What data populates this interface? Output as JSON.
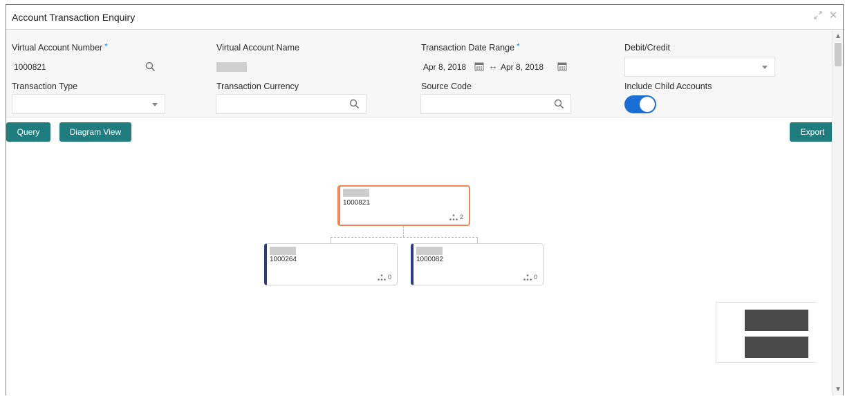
{
  "window": {
    "title": "Account Transaction Enquiry",
    "minimize_icon": "collapse-arrows-icon",
    "close_icon": "close-icon"
  },
  "form": {
    "virtual_account_number": {
      "label": "Virtual Account Number",
      "required_mark": "*",
      "value": "1000821",
      "icon": "search-icon"
    },
    "virtual_account_name": {
      "label": "Virtual Account Name",
      "value_masked": true
    },
    "transaction_date_range": {
      "label": "Transaction Date Range",
      "required_mark": "*",
      "from": "Apr 8, 2018",
      "to": "Apr 8, 2018",
      "separator": "↔",
      "icon": "calendar-icon"
    },
    "debit_credit": {
      "label": "Debit/Credit",
      "value": ""
    },
    "transaction_type": {
      "label": "Transaction Type",
      "value": ""
    },
    "transaction_currency": {
      "label": "Transaction Currency",
      "value": "",
      "icon": "search-icon"
    },
    "source_code": {
      "label": "Source Code",
      "value": "",
      "icon": "search-icon"
    },
    "include_child_accounts": {
      "label": "Include Child Accounts",
      "on": true
    }
  },
  "toolbar": {
    "query_label": "Query",
    "diagram_view_label": "Diagram View",
    "export_label": "Export"
  },
  "diagram": {
    "root": {
      "id": "1000821",
      "child_count": "2"
    },
    "children": [
      {
        "id": "1000264",
        "child_count": "0"
      },
      {
        "id": "1000082",
        "child_count": "0"
      }
    ]
  },
  "colors": {
    "accent_button": "#1f7d80",
    "toggle_on": "#1a6fd6",
    "root_border": "#ef8554",
    "child_border": "#2d3a8c",
    "required": "#1a8de0"
  }
}
